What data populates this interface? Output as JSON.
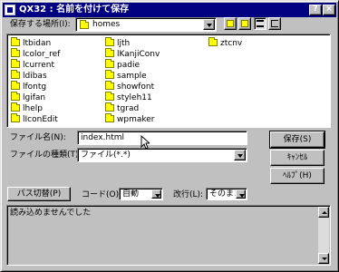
{
  "window": {
    "title": "QX32 : 名前を付けて保存",
    "help_label": "?",
    "close_label": "×"
  },
  "location": {
    "label": "保存する場所(I):",
    "value": "homes"
  },
  "files": [
    {
      "name": "ltbidan"
    },
    {
      "name": "lcolor_ref"
    },
    {
      "name": "lcurrent"
    },
    {
      "name": "ldibas"
    },
    {
      "name": "lfontg"
    },
    {
      "name": "lgifan"
    },
    {
      "name": "lhelp"
    },
    {
      "name": "lIconEdit"
    },
    {
      "name": "ljth"
    },
    {
      "name": "lKanjiConv"
    },
    {
      "name": "padie"
    },
    {
      "name": "sample"
    },
    {
      "name": "showfont"
    },
    {
      "name": "styleh11"
    },
    {
      "name": "tgrad"
    },
    {
      "name": "wpmaker"
    },
    {
      "name": "ztcnv"
    }
  ],
  "filename": {
    "label": "ファイル名(N):",
    "value": "index.html"
  },
  "filetype": {
    "label": "ファイルの種類(T):",
    "value": "ファイル(*.*)"
  },
  "buttons": {
    "save": "保存(S)",
    "cancel": "ｷｬﾝｾﾙ",
    "help": "ﾍﾙﾌﾟ(H)",
    "path_switch": "パス切替(P)"
  },
  "code": {
    "label": "コード(O):",
    "value": "自動"
  },
  "newline": {
    "label": "改行(L):",
    "value": "そのまま"
  },
  "status": {
    "text": "読み込めませんでした"
  }
}
